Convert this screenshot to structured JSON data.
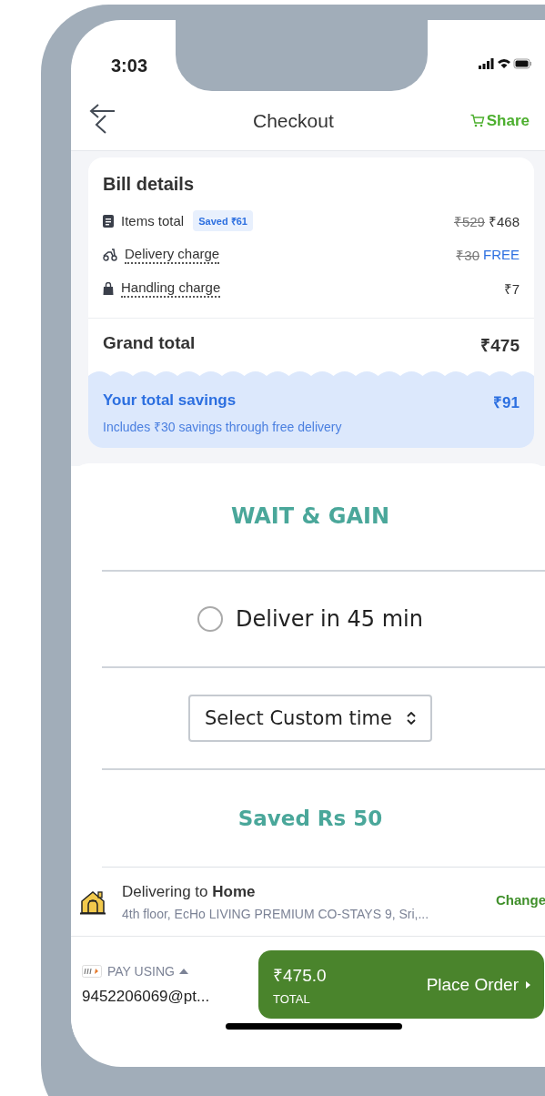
{
  "status_bar": {
    "time": "3:03"
  },
  "header": {
    "title": "Checkout",
    "share": "Share"
  },
  "bill": {
    "title": "Bill details",
    "rows": [
      {
        "kind": "items",
        "label": "Items total",
        "badge": "Saved ₹61",
        "original": "₹529",
        "price": "₹468",
        "free": false
      },
      {
        "kind": "delivery",
        "label": "Delivery charge",
        "original": "₹30",
        "price": "FREE",
        "free": true
      },
      {
        "kind": "handling",
        "label": "Handling charge",
        "price": "₹7",
        "free": false
      }
    ],
    "grand_total": {
      "label": "Grand total",
      "value": "₹475"
    },
    "savings": {
      "label": "Your total savings",
      "value": "₹91",
      "note": "Includes ₹30 savings through free delivery"
    }
  },
  "schedule": {
    "heading": "WAIT & GAIN",
    "option": {
      "label": "Deliver in 45 min",
      "selected": false
    },
    "custom_time": "Select Custom time",
    "saved": "Saved Rs 50"
  },
  "address": {
    "text": "Delivering to **Home**",
    "detail": "4th floor, EcHo LIVING PREMIUM CO-STAYS 9, Sri,...",
    "action": "Change"
  },
  "payment": {
    "label": "PAY USING",
    "account": "9452206069@pt...",
    "amount": "₹475.0",
    "amount_label": "TOTAL",
    "button": "Place Order"
  }
}
